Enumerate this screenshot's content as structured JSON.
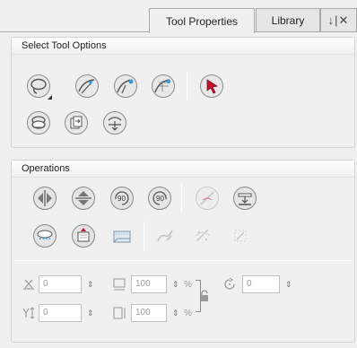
{
  "tabs": {
    "tool_properties": "Tool Properties",
    "library": "Library",
    "controls": "↓|✕"
  },
  "select_tool_options": {
    "title": "Select Tool Options",
    "buttons": [
      {
        "name": "lasso-icon"
      },
      {
        "name": "snap-and-align-icon"
      },
      {
        "name": "snap-to-contour-icon"
      },
      {
        "name": "snap-to-grid-icon"
      },
      {
        "name": "select-arrow-icon"
      },
      {
        "name": "apply-to-line-and-colour-icon"
      },
      {
        "name": "apply-to-all-drawings-icon"
      },
      {
        "name": "permanent-selection-icon"
      }
    ]
  },
  "operations": {
    "title": "Operations",
    "buttons": [
      {
        "name": "flip-horizontal-icon"
      },
      {
        "name": "flip-vertical-icon"
      },
      {
        "name": "rotate-90-cw-icon",
        "label": "90"
      },
      {
        "name": "rotate-90-ccw-icon",
        "label": "90"
      },
      {
        "name": "smooth-icon"
      },
      {
        "name": "flatten-icon"
      },
      {
        "name": "create-colour-art-icon"
      },
      {
        "name": "create-empty-art-icon"
      },
      {
        "name": "distribute-to-layers-icon"
      },
      {
        "name": "convert-pencil-lines-icon"
      },
      {
        "name": "remove-dirt-icon"
      },
      {
        "name": "convert-brush-to-pencil-icon"
      }
    ],
    "fields": {
      "x_value": "0",
      "y_value": "0",
      "width_value": "100",
      "height_value": "100",
      "angle_value": "0",
      "percent_unit": "%"
    }
  },
  "colors": {
    "accent_red": "#c8102e",
    "icon_grey": "#8a8a8a",
    "icon_blue": "#3a9ad9"
  }
}
